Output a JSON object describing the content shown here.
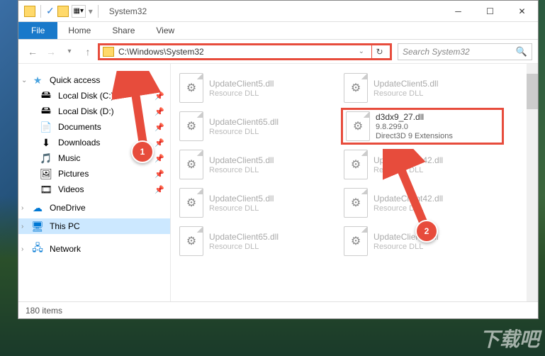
{
  "title": "System32",
  "ribbon": {
    "file": "File",
    "home": "Home",
    "share": "Share",
    "view": "View"
  },
  "address": "C:\\Windows\\System32",
  "search_placeholder": "Search System32",
  "nav": {
    "quick": "Quick access",
    "items": [
      {
        "label": "Local Disk (C:)",
        "icon": "🖴"
      },
      {
        "label": "Local Disk (D:)",
        "icon": "🖴"
      },
      {
        "label": "Documents",
        "icon": "📄"
      },
      {
        "label": "Downloads",
        "icon": "⬇"
      },
      {
        "label": "Music",
        "icon": "🎵"
      },
      {
        "label": "Pictures",
        "icon": "🖼"
      },
      {
        "label": "Videos",
        "icon": "🎞"
      }
    ],
    "onedrive": "OneDrive",
    "thispc": "This PC",
    "network": "Network"
  },
  "files": [
    {
      "name": "UpdateClient5.dll",
      "desc": "Resource DLL"
    },
    {
      "name": "UpdateClient5.dll",
      "desc": "Resource DLL"
    },
    {
      "name": "UpdateClient65.dll",
      "desc": "Resource DLL"
    },
    {
      "name": "d3dx9_27.dll",
      "ver": "9.8.299.0",
      "desc": "Direct3D 9 Extensions",
      "hl": true
    },
    {
      "name": "UpdateClient5.dll",
      "desc": "Resource DLL"
    },
    {
      "name": "UpdateClient42.dll",
      "desc": "Resource DLL"
    },
    {
      "name": "UpdateClient5.dll",
      "desc": "Resource DLL"
    },
    {
      "name": "UpdateClient42.dll",
      "desc": "Resource DLL"
    },
    {
      "name": "UpdateClient65.dll",
      "desc": "Resource DLL"
    },
    {
      "name": "UpdateClient5.dll",
      "desc": "Resource DLL"
    }
  ],
  "status": "180 items",
  "annots": {
    "b1": "1",
    "b2": "2"
  },
  "watermark": "下载吧"
}
